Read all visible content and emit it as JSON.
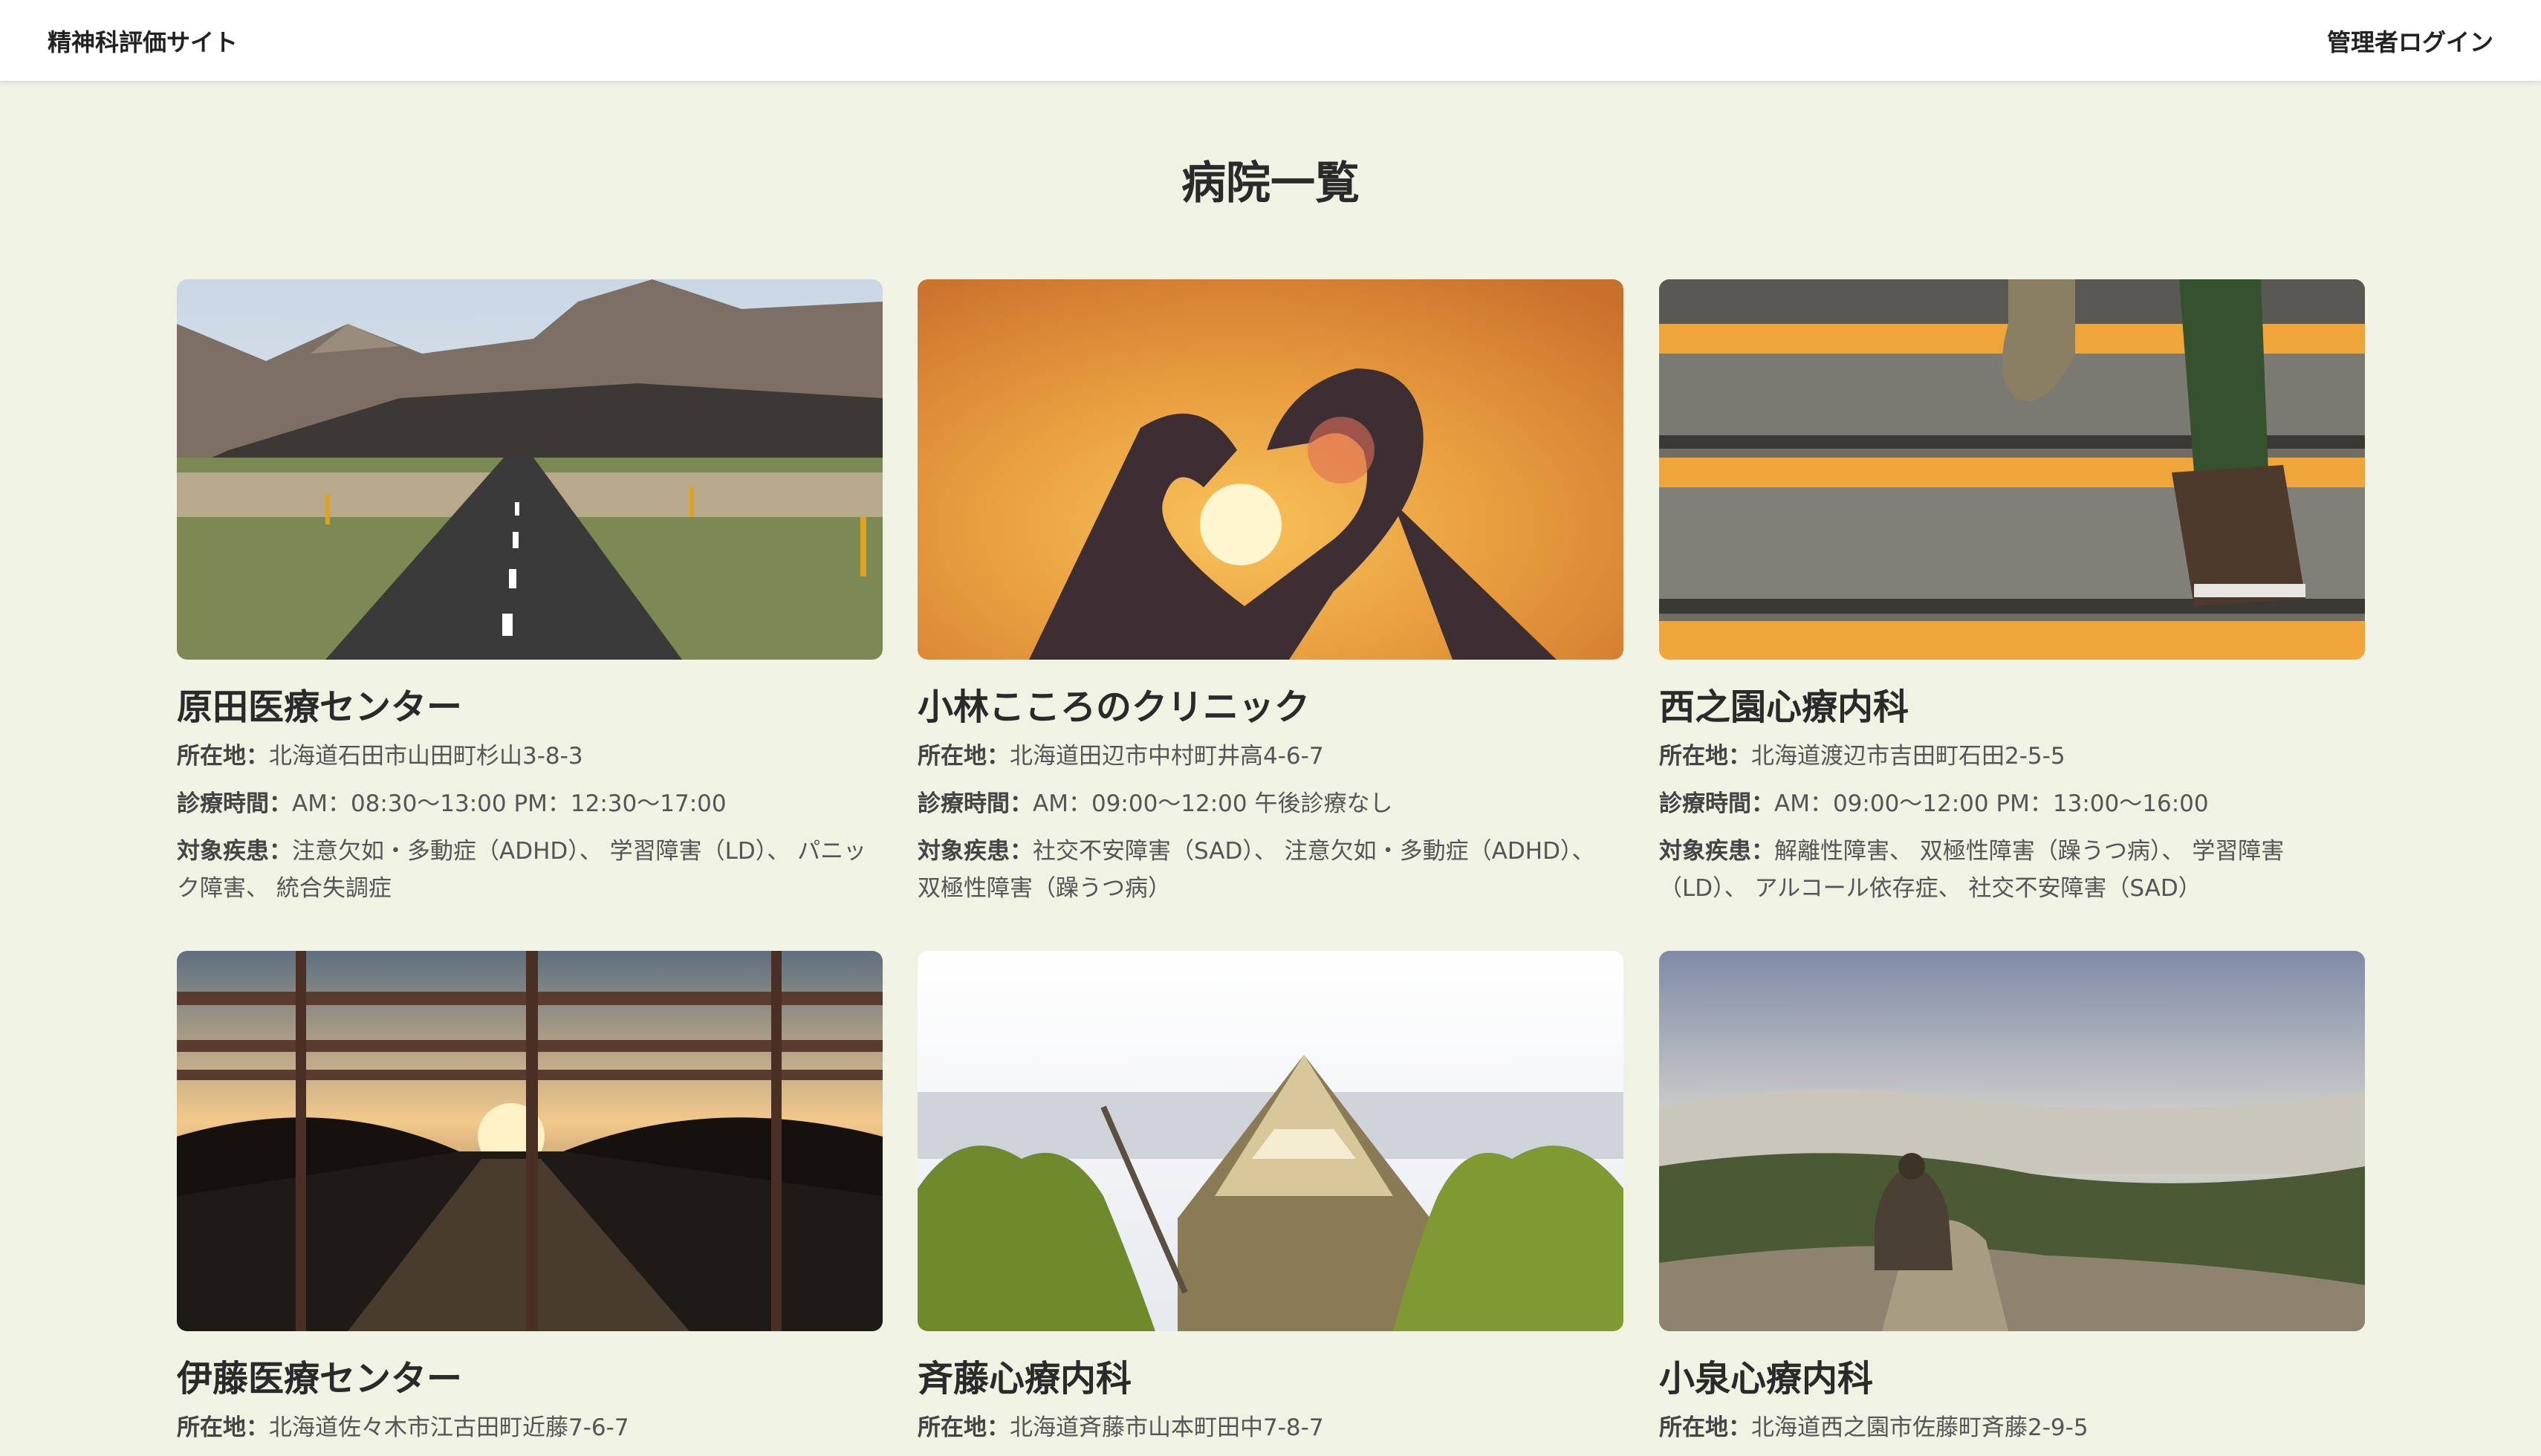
{
  "header": {
    "site_title": "精神科評価サイト",
    "admin_login": "管理者ログイン"
  },
  "page": {
    "title": "病院一覧"
  },
  "labels": {
    "location": "所在地：",
    "hours": "診療時間：",
    "diseases": "対象疾患："
  },
  "hospitals": [
    {
      "name": "原田医療センター",
      "location": "北海道石田市山田町杉山3-8-3",
      "hours": "AM：08:30〜13:00 PM：12:30〜17:00",
      "diseases": "注意欠如・多動症（ADHD）、 学習障害（LD）、 パニック障害、 統合失調症"
    },
    {
      "name": "小林こころのクリニック",
      "location": "北海道田辺市中村町井高4-6-7",
      "hours": "AM：09:00〜12:00 午後診療なし",
      "diseases": "社交不安障害（SAD）、 注意欠如・多動症（ADHD）、 双極性障害（躁うつ病）"
    },
    {
      "name": "西之園心療内科",
      "location": "北海道渡辺市吉田町石田2-5-5",
      "hours": "AM：09:00〜12:00 PM：13:00〜16:00",
      "diseases": "解離性障害、 双極性障害（躁うつ病）、 学習障害（LD）、 アルコール依存症、 社交不安障害（SAD）"
    },
    {
      "name": "伊藤医療センター",
      "location": "北海道佐々木市江古田町近藤7-6-7"
    },
    {
      "name": "斉藤心療内科",
      "location": "北海道斉藤市山本町田中7-8-7"
    },
    {
      "name": "小泉心療内科",
      "location": "北海道西之園市佐藤町斉藤2-9-5"
    }
  ]
}
